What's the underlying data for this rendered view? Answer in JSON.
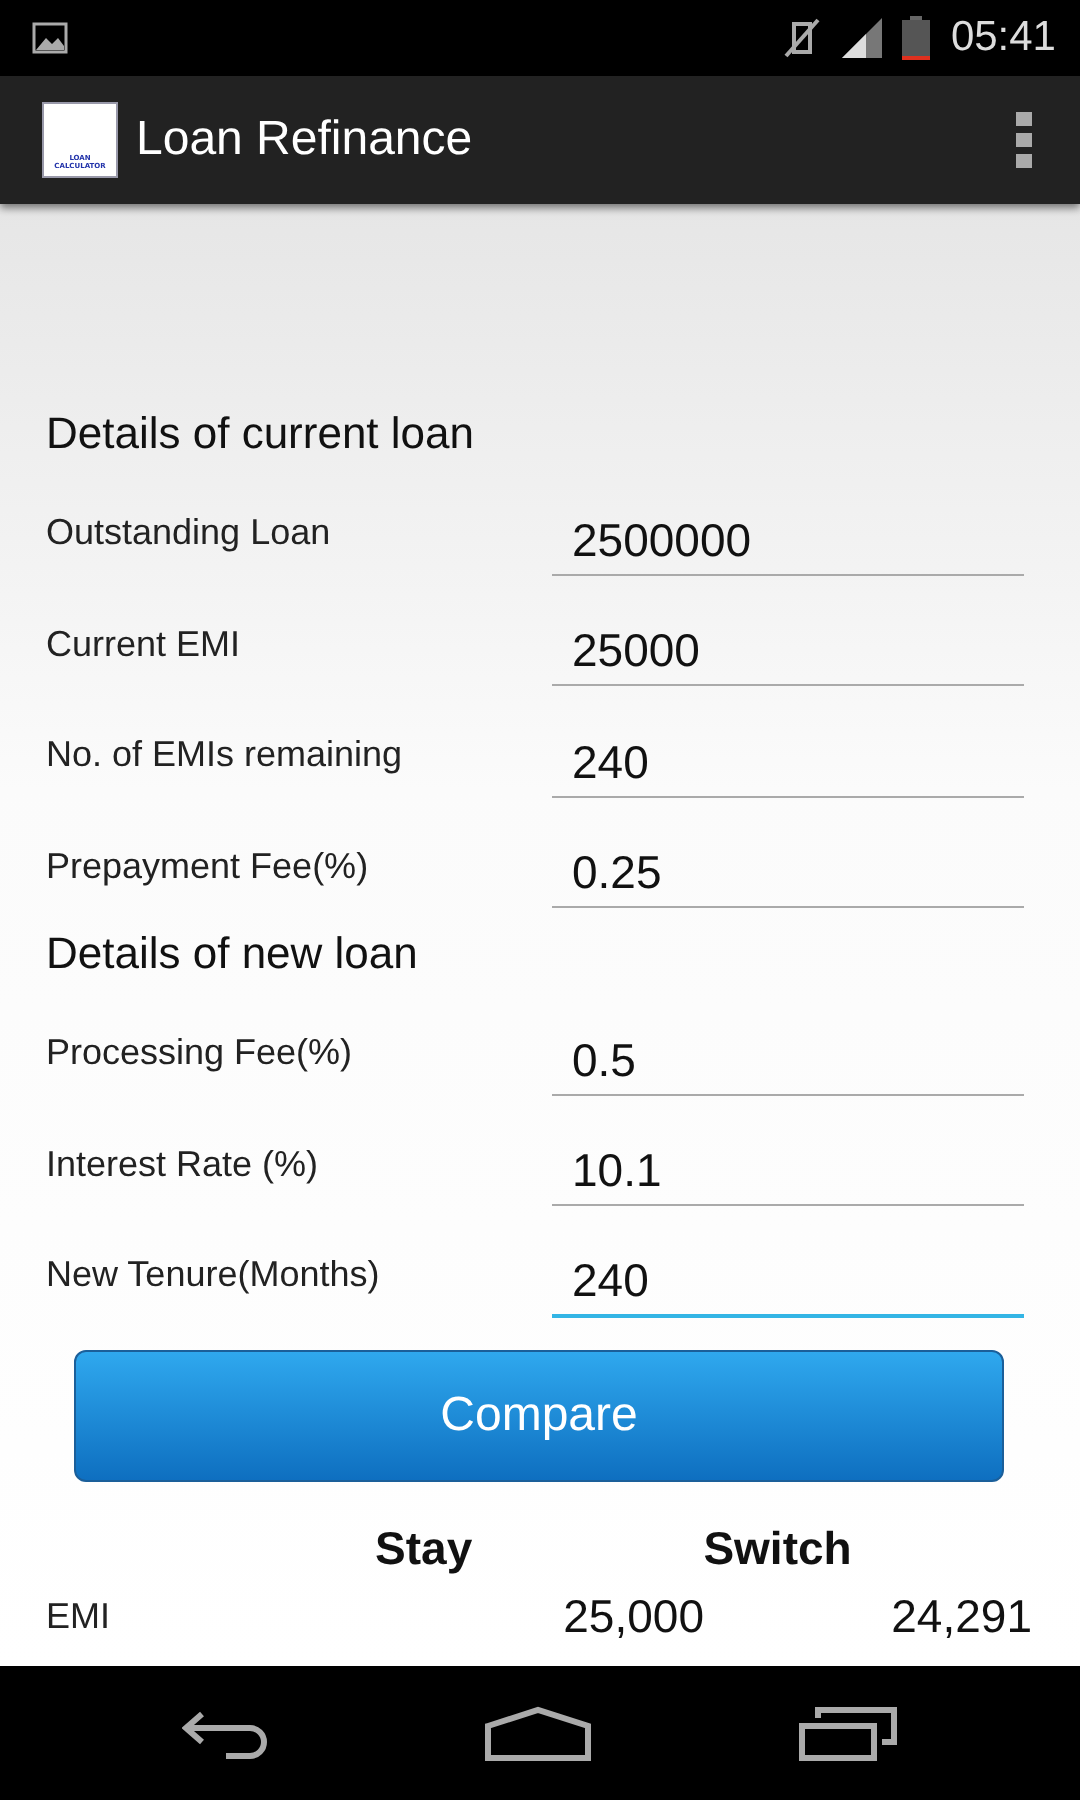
{
  "status_bar": {
    "time": "05:41"
  },
  "action_bar": {
    "logo_text": [
      "LOAN",
      "CALCULATOR"
    ],
    "title": "Loan Refinance"
  },
  "sections": [
    {
      "heading": "Details of current loan",
      "fields": [
        {
          "label": "Outstanding Loan",
          "value": "2500000",
          "focused": false
        },
        {
          "label": "Current EMI",
          "value": "25000",
          "focused": false
        },
        {
          "label": "No. of EMIs remaining",
          "value": "240",
          "focused": false
        },
        {
          "label": "Prepayment Fee(%)",
          "value": "0.25",
          "focused": false
        }
      ]
    },
    {
      "heading": "Details of new loan",
      "fields": [
        {
          "label": "Processing Fee(%)",
          "value": "0.5",
          "focused": false
        },
        {
          "label": "Interest Rate (%)",
          "value": "10.1",
          "focused": false
        },
        {
          "label": "New Tenure(Months)",
          "value": "240",
          "focused": true
        }
      ]
    }
  ],
  "compare_button": "Compare",
  "results": {
    "columns": [
      "Stay",
      "Switch"
    ],
    "rows": [
      {
        "label": "EMI",
        "stay": "25,000",
        "switch": "24,291"
      }
    ]
  }
}
